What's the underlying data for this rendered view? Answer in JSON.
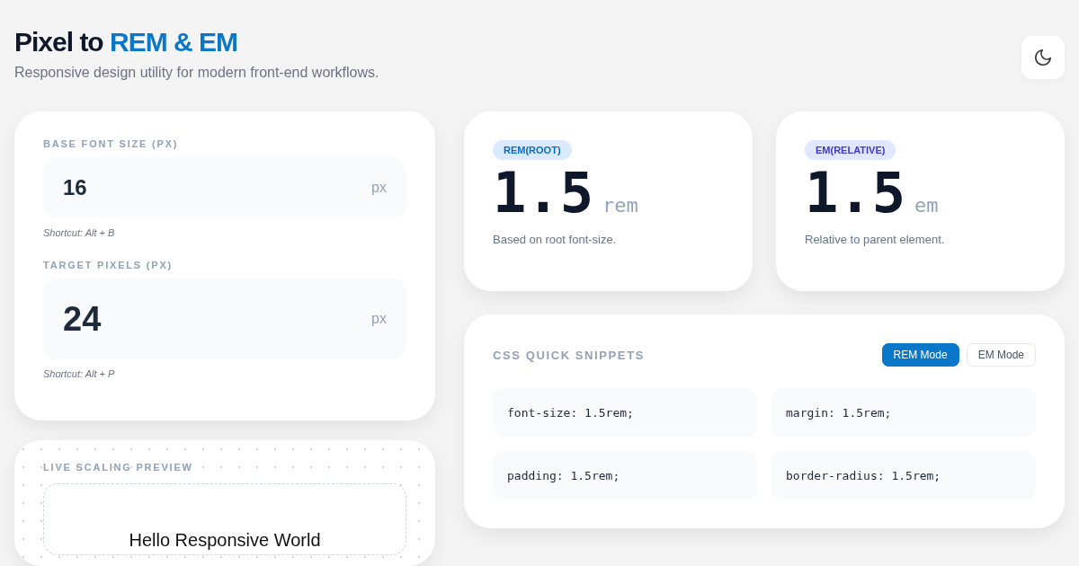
{
  "header": {
    "title_start": "Pixel to",
    "title_accent": "REM & EM",
    "subtitle": "Responsive design utility for modern front-end workflows."
  },
  "inputs": [
    {
      "label": "BASE FONT SIZE (PX)",
      "value": "16",
      "unit": "px",
      "hint": "Shortcut: Alt + B"
    },
    {
      "label": "TARGET PIXELS (PX)",
      "value": "24",
      "unit": "px",
      "hint": "Shortcut: Alt + P"
    }
  ],
  "preview": {
    "label": "LIVE SCALING PREVIEW",
    "sample": "Hello Responsive World"
  },
  "results": [
    {
      "kind": "rem",
      "badge": "REM(ROOT)",
      "value": "1.5",
      "unit": "rem",
      "note": "Based on root font-size."
    },
    {
      "kind": "em",
      "badge": "EM(RELATIVE)",
      "value": "1.5",
      "unit": "em",
      "note": "Relative to parent element."
    }
  ],
  "snippets": {
    "title": "CSS QUICK SNIPPETS",
    "modes": [
      {
        "label": "REM Mode",
        "selected": true
      },
      {
        "label": "EM Mode",
        "selected": false
      }
    ],
    "items": [
      "font-size: 1.5rem;",
      "margin: 1.5rem;",
      "padding: 1.5rem;",
      "border-radius: 1.5rem;"
    ]
  }
}
